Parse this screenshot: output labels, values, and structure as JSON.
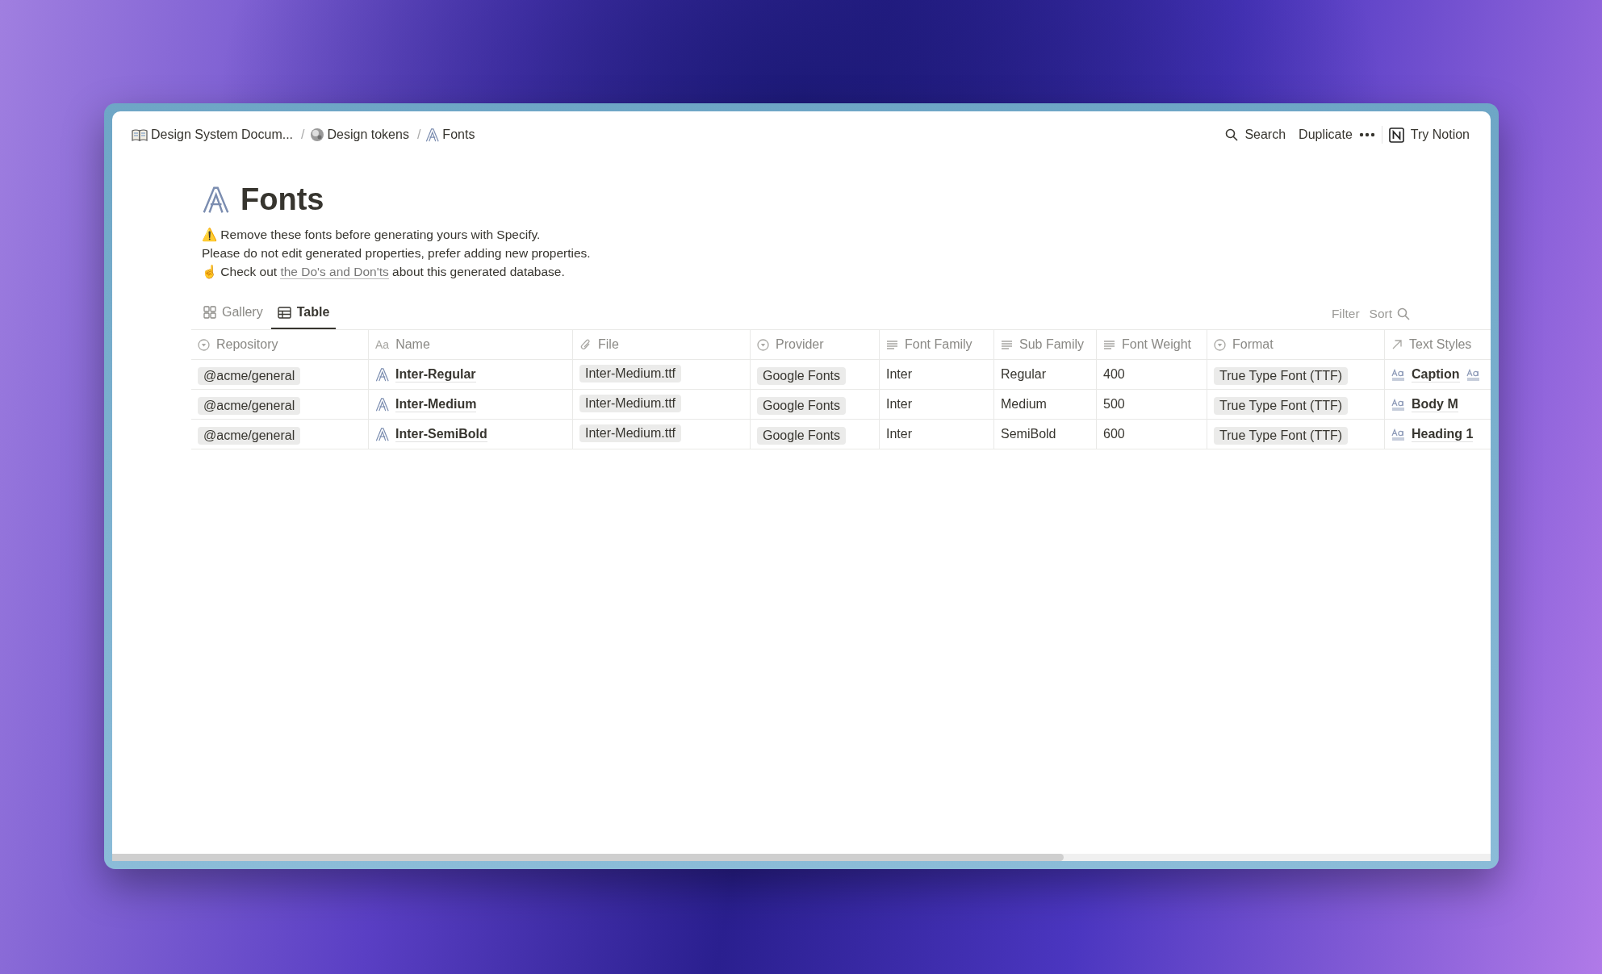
{
  "breadcrumbs": [
    {
      "kind": "book",
      "label": "Design System Docum..."
    },
    {
      "kind": "globe",
      "label": "Design tokens"
    },
    {
      "kind": "font",
      "label": "Fonts"
    }
  ],
  "breadcrumb_separator": "/",
  "top_actions": {
    "search": "Search",
    "duplicate": "Duplicate",
    "try_notion": "Try Notion"
  },
  "page": {
    "title": "Fonts",
    "description": [
      {
        "icon": "⚠️",
        "text": "Remove these fonts before generating yours with Specify."
      },
      {
        "text": "Please do not edit generated properties, prefer adding new properties."
      },
      {
        "icon": "☝",
        "before": "Check out",
        "link": "the Do's and Don'ts",
        "after": "about this generated database."
      }
    ]
  },
  "views": [
    {
      "kind": "gallery",
      "label": "Gallery",
      "selected": false
    },
    {
      "kind": "table",
      "label": "Table",
      "selected": true
    }
  ],
  "view_actions": [
    "Filter",
    "Sort"
  ],
  "table": {
    "columns": [
      {
        "kind": "select",
        "label": "Repository"
      },
      {
        "kind": "title",
        "icon_text": "Aa",
        "label": "Name"
      },
      {
        "kind": "file",
        "label": "File"
      },
      {
        "kind": "select",
        "label": "Provider"
      },
      {
        "kind": "text",
        "label": "Font Family"
      },
      {
        "kind": "text",
        "label": "Sub Family"
      },
      {
        "kind": "text",
        "label": "Font Weight"
      },
      {
        "kind": "select",
        "label": "Format"
      },
      {
        "kind": "relation",
        "label": "Text Styles"
      }
    ],
    "rows": [
      {
        "repository": "@acme/general",
        "name": "Inter-Regular",
        "file": "Inter-Medium.ttf",
        "provider": "Google Fonts",
        "font_family": "Inter",
        "sub_family": "Regular",
        "font_weight": "400",
        "format": "True Type Font (TTF)",
        "text_style": "Caption",
        "more_styles": true
      },
      {
        "repository": "@acme/general",
        "name": "Inter-Medium",
        "file": "Inter-Medium.ttf",
        "provider": "Google Fonts",
        "font_family": "Inter",
        "sub_family": "Medium",
        "font_weight": "500",
        "format": "True Type Font (TTF)",
        "text_style": "Body M",
        "more_styles": false
      },
      {
        "repository": "@acme/general",
        "name": "Inter-SemiBold",
        "file": "Inter-Medium.ttf",
        "provider": "Google Fonts",
        "font_family": "Inter",
        "sub_family": "SemiBold",
        "font_weight": "600",
        "format": "True Type Font (TTF)",
        "text_style": "Heading 1",
        "more_styles": false
      }
    ]
  }
}
